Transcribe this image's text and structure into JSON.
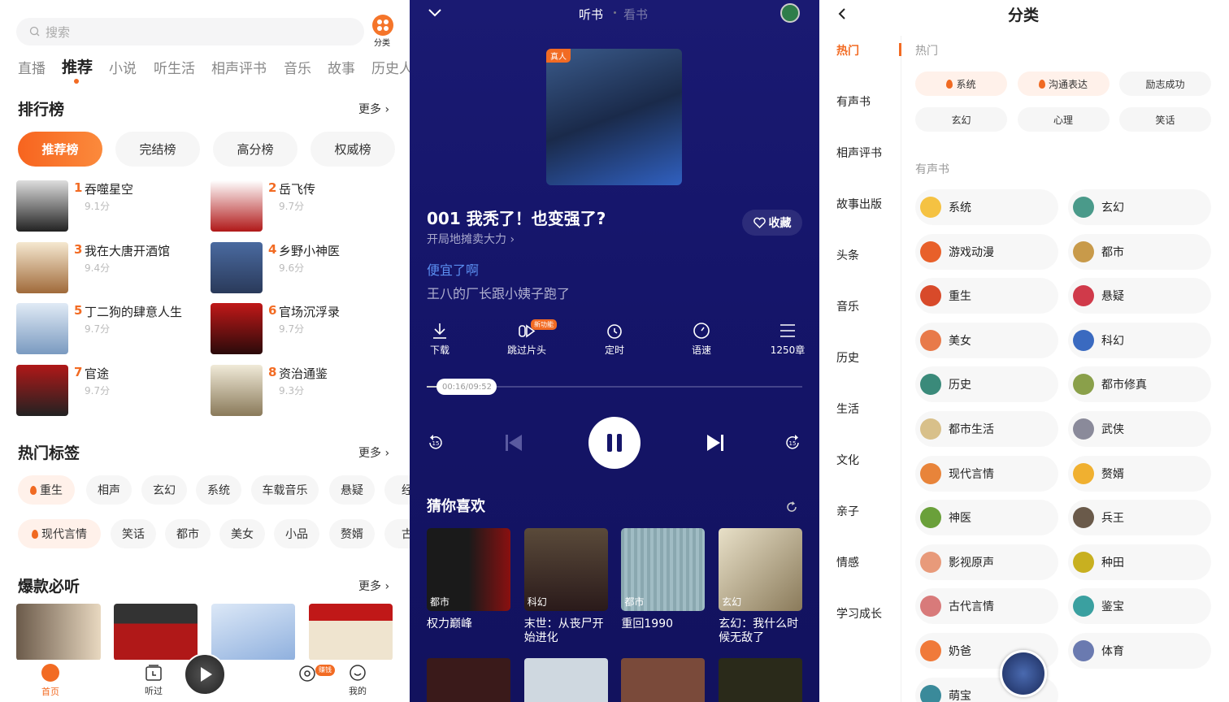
{
  "left": {
    "search_placeholder": "搜索",
    "category_label": "分类",
    "tabs": [
      "直播",
      "推荐",
      "小说",
      "听生活",
      "相声评书",
      "音乐",
      "故事",
      "历史人"
    ],
    "active_tab": 1,
    "ranking": {
      "title": "排行榜",
      "more": "更多 ›",
      "pills": [
        "推荐榜",
        "完结榜",
        "高分榜",
        "权威榜"
      ],
      "active_pill": 0,
      "items": [
        {
          "num": "1",
          "title": "吞噬星空",
          "score": "9.1分"
        },
        {
          "num": "2",
          "title": "岳飞传",
          "score": "9.7分"
        },
        {
          "num": "3",
          "title": "我在大唐开酒馆",
          "score": "9.4分"
        },
        {
          "num": "4",
          "title": "乡野小神医",
          "score": "9.6分"
        },
        {
          "num": "5",
          "title": "丁二狗的肆意人生",
          "score": "9.7分"
        },
        {
          "num": "6",
          "title": "官场沉浮录",
          "score": "9.7分"
        },
        {
          "num": "7",
          "title": "官途",
          "score": "9.7分"
        },
        {
          "num": "8",
          "title": "资治通鉴",
          "score": "9.3分"
        }
      ]
    },
    "hot_tags": {
      "title": "热门标签",
      "more": "更多 ›",
      "row1": [
        {
          "label": "重生",
          "hot": true
        },
        {
          "label": "相声"
        },
        {
          "label": "玄幻"
        },
        {
          "label": "系统"
        },
        {
          "label": "车载音乐"
        },
        {
          "label": "悬疑"
        },
        {
          "label": "经"
        }
      ],
      "row2": [
        {
          "label": "现代言情",
          "hot": true
        },
        {
          "label": "笑话"
        },
        {
          "label": "都市"
        },
        {
          "label": "美女"
        },
        {
          "label": "小品"
        },
        {
          "label": "赘婿"
        },
        {
          "label": "古"
        }
      ]
    },
    "must_listen": {
      "title": "爆款必听",
      "more": "更多 ›"
    },
    "bottom_nav": {
      "home": "首页",
      "history": "听过",
      "earn_badge": "赚钱",
      "mine": "我的"
    },
    "accent": "#f26b23"
  },
  "mid": {
    "tabs": [
      "听书",
      "看书"
    ],
    "cover_badge": "真人",
    "episode_title": "001 我秃了！也变强了?",
    "book_title": "开局地摊卖大力 ›",
    "favorite": "收藏",
    "lyric_current": "便宜了啊",
    "lyric_next": "王八的厂长跟小姨子跑了",
    "controls": [
      "下载",
      "跳过片头",
      "定时",
      "语速",
      "1250章"
    ],
    "new_badge": "新功能",
    "progress": {
      "time": "00:16/09:52",
      "fraction": 0.027
    },
    "state": "playing",
    "guess": {
      "title": "猜你喜欢",
      "items": [
        {
          "tag": "都市",
          "title": "权力巅峰"
        },
        {
          "tag": "科幻",
          "title": "末世：从丧尸开始进化"
        },
        {
          "tag": "都市",
          "title": "重回1990"
        },
        {
          "tag": "玄幻",
          "title": "玄幻：我什么时候无敌了"
        }
      ]
    },
    "background": "#15156a",
    "lyric_color": "#5b8ef0"
  },
  "right": {
    "title": "分类",
    "sidebar": [
      "热门",
      "有声书",
      "相声评书",
      "故事出版",
      "头条",
      "音乐",
      "历史",
      "生活",
      "文化",
      "亲子",
      "情感",
      "学习成长"
    ],
    "active": 0,
    "hot_title": "热门",
    "hot_chips": [
      {
        "label": "系统",
        "hot": true
      },
      {
        "label": "沟通表达",
        "hot": true
      },
      {
        "label": "励志成功"
      },
      {
        "label": "玄幻"
      },
      {
        "label": "心理"
      },
      {
        "label": "笑话"
      }
    ],
    "audiobook_title": "有声书",
    "categories": [
      "系统",
      "玄幻",
      "游戏动漫",
      "都市",
      "重生",
      "悬疑",
      "美女",
      "科幻",
      "历史",
      "都市修真",
      "都市生活",
      "武侠",
      "现代言情",
      "赘婿",
      "神医",
      "兵王",
      "影视原声",
      "种田",
      "古代言情",
      "鉴宝",
      "奶爸",
      "体育",
      "萌宝"
    ]
  }
}
